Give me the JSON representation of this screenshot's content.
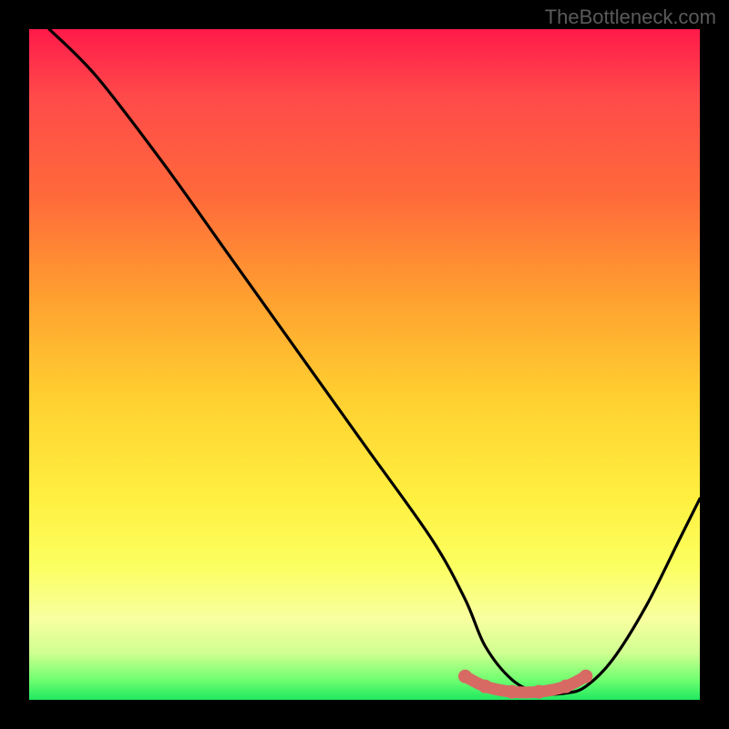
{
  "watermark": "TheBottleneck.com",
  "chart_data": {
    "type": "line",
    "title": "",
    "xlabel": "",
    "ylabel": "",
    "xlim": [
      0,
      100
    ],
    "ylim": [
      0,
      100
    ],
    "series": [
      {
        "name": "bottleneck-curve",
        "x": [
          3,
          10,
          20,
          30,
          40,
          50,
          60,
          65,
          68,
          72,
          76,
          80,
          83,
          87,
          92,
          97,
          100
        ],
        "y": [
          100,
          93,
          80,
          66,
          52,
          38,
          24,
          15,
          8,
          3,
          1,
          1,
          2,
          6,
          14,
          24,
          30
        ]
      }
    ],
    "highlight": {
      "name": "flat-bottom",
      "x": [
        65,
        68,
        72,
        76,
        80,
        83
      ],
      "y": [
        3.5,
        2,
        1.2,
        1.2,
        2,
        3.5
      ],
      "color": "#d86a64"
    }
  }
}
